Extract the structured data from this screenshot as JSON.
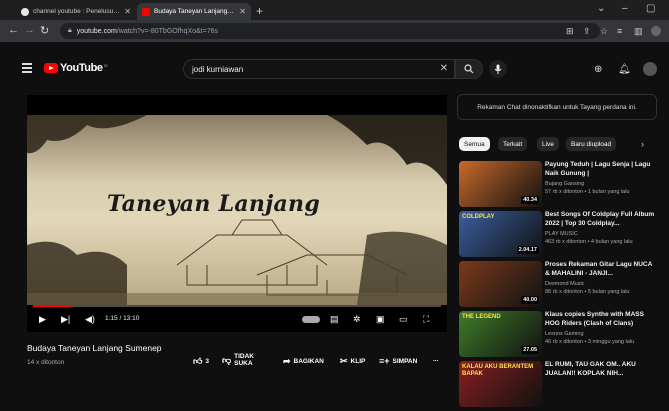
{
  "browser": {
    "tabs": [
      {
        "label": "channel youtube : Penelusuran G",
        "active": false
      },
      {
        "label": "Budaya Taneyan Lanjang Su",
        "active": true
      }
    ],
    "new_tab": "+",
    "url_host": "youtube.com",
    "url_path": "/watch?v=-80TbGOfhqXo&t=76s",
    "window_controls": [
      "⌄",
      "–",
      "▢"
    ]
  },
  "youtube": {
    "logo_text": "YouTube",
    "logo_sup": "ID",
    "search_value": "jodi kurniawan"
  },
  "player": {
    "overlay_title": "Taneyan Lanjang",
    "time": "1:15 / 13:10",
    "progress_fraction": 0.095
  },
  "video": {
    "title": "Budaya Taneyan Lanjang Sumenep",
    "views": "14 x ditonton",
    "like_count": "3",
    "dislike_label": "TIDAK SUKA",
    "share_label": "BAGIKAN",
    "clip_label": "KLIP",
    "save_label": "SIMPAN",
    "more_label": "..."
  },
  "sidebar": {
    "chat_notice": "Rekaman Chat dinonaktifkan untuk Tayang perdana ini.",
    "chips": [
      "Semua",
      "Terkait",
      "Live",
      "Baru diupload"
    ],
    "recommendations": [
      {
        "title": "Payung Teduh | Lagu Senja | Lagu Naik Gunung |",
        "channel": "Bujang Gansing",
        "meta": "57 rb x ditonton • 1 bulan yang lalu",
        "duration": "40.34",
        "color": "#c86a2a"
      },
      {
        "title": "Best Songs Of Coldplay Full Album 2022 | Top 30 Coldplay...",
        "channel": "PLAY MUSIC",
        "meta": "463 rb x ditonton • 4 bulan yang lalu",
        "duration": "2.04.17",
        "color": "#3a5fa0",
        "thumb_text": "COLDPLAY"
      },
      {
        "title": "Proses Rekaman Gitar Lagu NUCA & MAHALINI - JANJI...",
        "channel": "Desmond Music",
        "meta": "88 rb x ditonton • 5 bulan yang lalu",
        "duration": "40.00",
        "color": "#7a3b1c"
      },
      {
        "title": "Klaus copies Synthe with MASS HOG Riders (Clash of Clans)",
        "channel": "Lesnos Gaming",
        "meta": "46 rb x ditonton • 3 minggu yang lalu",
        "duration": "27.05",
        "color": "#3f7d2a",
        "thumb_text": "THE LEGEND"
      },
      {
        "title": "EL RUMI, TAU GAK OM.. AKU JUALAN!! KOPLAK NIH...",
        "channel": "",
        "meta": "",
        "duration": "",
        "color": "#8a1f1f",
        "thumb_text": "KALAU AKU BERANTEM BAPAK"
      }
    ]
  }
}
